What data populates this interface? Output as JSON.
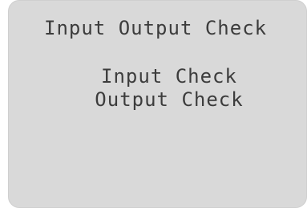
{
  "screen": {
    "title": "Input Output Check",
    "menu": [
      {
        "label": "Input Check"
      },
      {
        "label": "Output Check"
      }
    ]
  },
  "colors": {
    "lcd_background": "#d9d9d9",
    "lcd_text": "#3c3c3c"
  }
}
